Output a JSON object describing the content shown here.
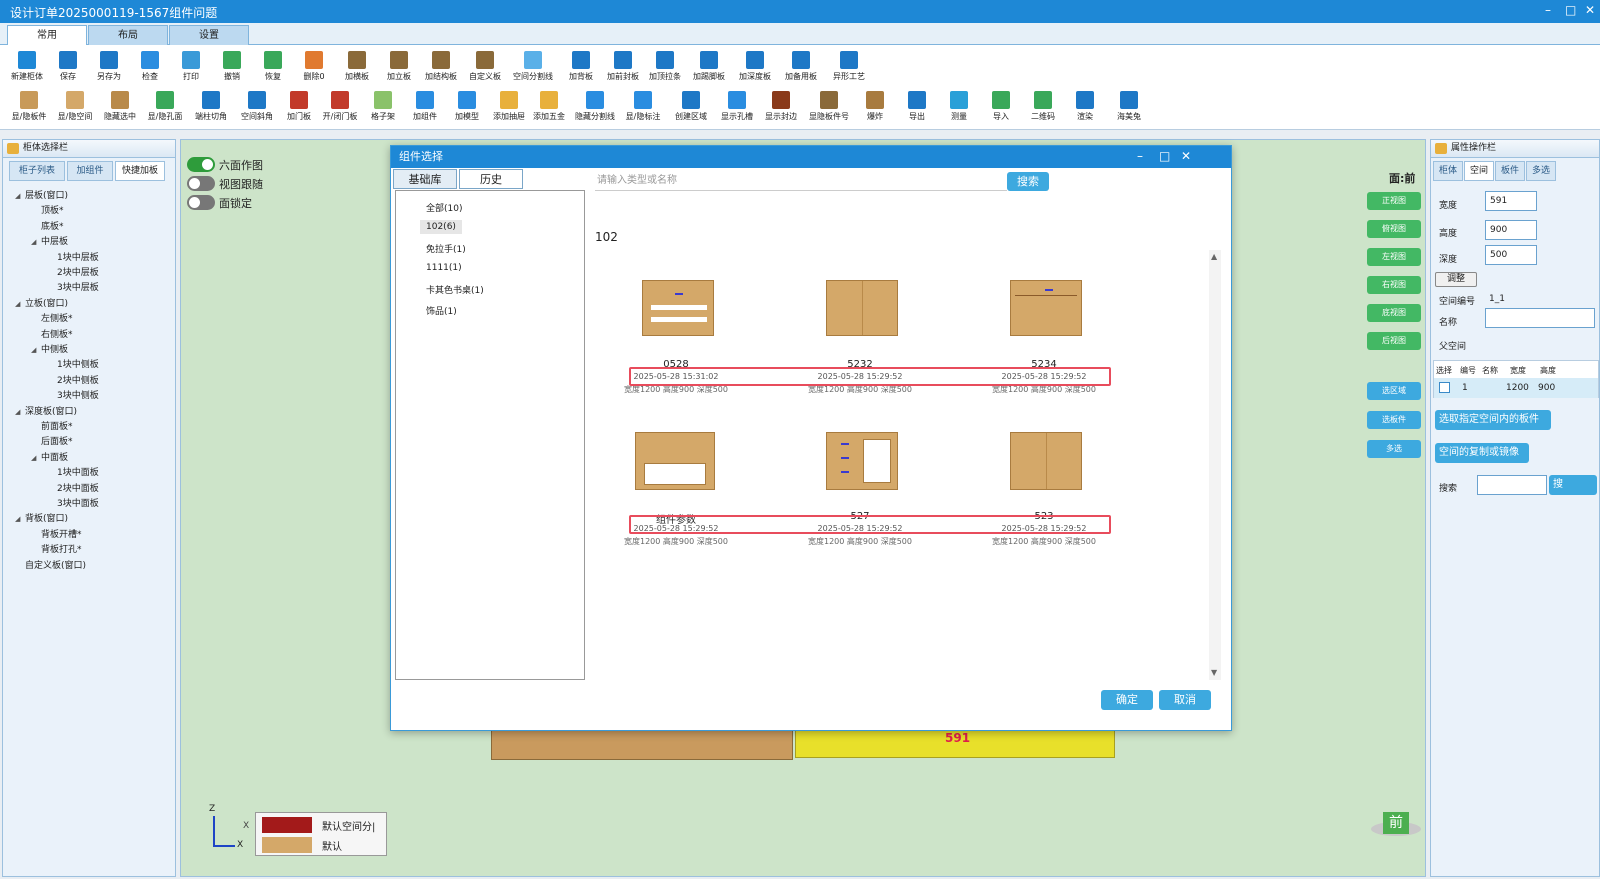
{
  "window": {
    "title": "设计订单2025000119-1567组件问题",
    "controls": [
      "–",
      "□",
      "✕"
    ]
  },
  "main_tabs": [
    {
      "label": "常用",
      "active": true
    },
    {
      "label": "布局",
      "active": false
    },
    {
      "label": "设置",
      "active": false
    }
  ],
  "ribbon_row1": [
    {
      "label": "新建柜体",
      "icon": "new-cabinet-icon",
      "color": "#1e88d6"
    },
    {
      "label": "保存",
      "icon": "save-icon",
      "color": "#1e78c6"
    },
    {
      "label": "另存为",
      "icon": "save-as-icon",
      "color": "#1e78c6"
    },
    {
      "label": "检查",
      "icon": "check-icon",
      "color": "#2a8de0"
    },
    {
      "label": "打印",
      "icon": "print-icon",
      "color": "#3a9ad8"
    },
    {
      "label": "撤销",
      "icon": "undo-icon",
      "color": "#3aa85a"
    },
    {
      "label": "恢复",
      "icon": "redo-icon",
      "color": "#3aa85a"
    },
    {
      "label": "删除0",
      "icon": "delete-icon",
      "color": "#e07a30"
    },
    {
      "label": "加横板",
      "icon": "add-horizontal-board-icon",
      "color": "#8a6a3a"
    },
    {
      "label": "加立板",
      "icon": "add-vertical-board-icon",
      "color": "#8a6a3a"
    },
    {
      "label": "加结构板",
      "icon": "add-structure-board-icon",
      "color": "#8a6a3a"
    },
    {
      "label": "自定义板",
      "icon": "custom-board-icon",
      "color": "#8a6a3a"
    },
    {
      "label": "空间分割线",
      "icon": "space-split-icon",
      "color": "#5ab0e8"
    },
    {
      "label": "加背板",
      "icon": "add-back-board-icon",
      "color": "#1e78c6"
    },
    {
      "label": "加前封板",
      "icon": "add-front-seal-icon",
      "color": "#1e78c6"
    },
    {
      "label": "加顶拉条",
      "icon": "add-top-strip-icon",
      "color": "#1e78c6"
    },
    {
      "label": "加踢脚板",
      "icon": "add-kick-board-icon",
      "color": "#1e78c6"
    },
    {
      "label": "加深度板",
      "icon": "add-depth-board-icon",
      "color": "#1e78c6"
    },
    {
      "label": "加备用板",
      "icon": "add-spare-board-icon",
      "color": "#1e78c6"
    },
    {
      "label": "异形工艺",
      "icon": "special-process-icon",
      "color": "#1e78c6"
    }
  ],
  "ribbon_row2": [
    {
      "label": "显/隐板件",
      "icon": "toggle-boards-icon",
      "color": "#c89a5a"
    },
    {
      "label": "显/隐空间",
      "icon": "toggle-space-icon",
      "color": "#d4a869"
    },
    {
      "label": "隐藏选中",
      "icon": "hide-selected-icon",
      "color": "#b98a4a"
    },
    {
      "label": "显/隐孔面",
      "icon": "toggle-hole-face-icon",
      "color": "#3aa85a"
    },
    {
      "label": "端柱切角",
      "icon": "post-chamfer-icon",
      "color": "#1e78c6"
    },
    {
      "label": "空间斜角",
      "icon": "space-bevel-icon",
      "color": "#1e78c6"
    },
    {
      "label": "加门板",
      "icon": "add-door-icon",
      "color": "#c23a2a"
    },
    {
      "label": "开/闭门板",
      "icon": "open-close-door-icon",
      "color": "#c23a2a"
    },
    {
      "label": "格子架",
      "icon": "grid-rack-icon",
      "color": "#8ac26a"
    },
    {
      "label": "加组件",
      "icon": "add-component-icon",
      "color": "#2a8de0"
    },
    {
      "label": "加模型",
      "icon": "add-model-icon",
      "color": "#2a8de0"
    },
    {
      "label": "添加抽屉",
      "icon": "add-drawer-icon",
      "color": "#e8b03c"
    },
    {
      "label": "添加五金",
      "icon": "add-hardware-icon",
      "color": "#e8b03c"
    },
    {
      "label": "隐藏分割线",
      "icon": "hide-split-line-icon",
      "color": "#2a8de0"
    },
    {
      "label": "显/隐标注",
      "icon": "toggle-annotation-icon",
      "color": "#2a8de0"
    },
    {
      "label": "创建区域",
      "icon": "create-area-icon",
      "color": "#1e78c6"
    },
    {
      "label": "显示孔槽",
      "icon": "show-hole-slot-icon",
      "color": "#2a8de0"
    },
    {
      "label": "显示封边",
      "icon": "show-edge-band-icon",
      "color": "#8a3a1a"
    },
    {
      "label": "显隐板件号",
      "icon": "toggle-board-number-icon",
      "color": "#8a6a3a"
    },
    {
      "label": "爆炸",
      "icon": "explode-icon",
      "color": "#a87b3f"
    },
    {
      "label": "导出",
      "icon": "export-icon",
      "color": "#1e78c6"
    },
    {
      "label": "测量",
      "icon": "measure-icon",
      "color": "#2aa0d8"
    },
    {
      "label": "导入",
      "icon": "import-icon",
      "color": "#3aa85a"
    },
    {
      "label": "二维码",
      "icon": "qrcode-icon",
      "color": "#3aa85a"
    },
    {
      "label": "渲染",
      "icon": "render-icon",
      "color": "#1e78c6"
    },
    {
      "label": "海美兔",
      "icon": "haimeitu-icon",
      "color": "#1e78c6"
    }
  ],
  "left_panel": {
    "title": "柜体选择栏",
    "tabs": [
      {
        "label": "柜子列表",
        "active": false
      },
      {
        "label": "加组件",
        "active": false
      },
      {
        "label": "快捷加板",
        "active": true
      }
    ],
    "tree": [
      {
        "label": "层板(窗口)",
        "level": 0,
        "expanded": true
      },
      {
        "label": "顶板*",
        "level": 1
      },
      {
        "label": "底板*",
        "level": 1
      },
      {
        "label": "中层板",
        "level": 1,
        "expanded": true
      },
      {
        "label": "1块中层板",
        "level": 2
      },
      {
        "label": "2块中层板",
        "level": 2
      },
      {
        "label": "3块中层板",
        "level": 2
      },
      {
        "label": "立板(窗口)",
        "level": 0,
        "expanded": true
      },
      {
        "label": "左侧板*",
        "level": 1
      },
      {
        "label": "右侧板*",
        "level": 1
      },
      {
        "label": "中侧板",
        "level": 1,
        "expanded": true
      },
      {
        "label": "1块中侧板",
        "level": 2
      },
      {
        "label": "2块中侧板",
        "level": 2
      },
      {
        "label": "3块中侧板",
        "level": 2
      },
      {
        "label": "深度板(窗口)",
        "level": 0,
        "expanded": true
      },
      {
        "label": "前面板*",
        "level": 1
      },
      {
        "label": "后面板*",
        "level": 1
      },
      {
        "label": "中面板",
        "level": 1,
        "expanded": true
      },
      {
        "label": "1块中面板",
        "level": 2
      },
      {
        "label": "2块中面板",
        "level": 2
      },
      {
        "label": "3块中面板",
        "level": 2
      },
      {
        "label": "背板(窗口)",
        "level": 0,
        "expanded": true
      },
      {
        "label": "背板开槽*",
        "level": 1
      },
      {
        "label": "背板打孔*",
        "level": 1
      },
      {
        "label": "自定义板(窗口)",
        "level": 0
      }
    ]
  },
  "canvas": {
    "toggles": [
      {
        "label": "六面作图",
        "on": true
      },
      {
        "label": "视图跟随",
        "on": false
      },
      {
        "label": "面锁定",
        "on": false
      }
    ],
    "face_label": "面:前",
    "view_buttons": [
      "正视图",
      "俯视图",
      "左视图",
      "右视图",
      "底视图",
      "后视图"
    ],
    "select_buttons": [
      "选区域",
      "选板件",
      "多选"
    ],
    "dimension_text": "591",
    "axis": {
      "z": "Z",
      "x": "X",
      "y": "X"
    },
    "legend": [
      {
        "label": "默认空间分|",
        "color": "#a31a1a"
      },
      {
        "label": "默认",
        "color": "#d4a869"
      }
    ],
    "front_badge": "前"
  },
  "right_panel": {
    "title": "属性操作栏",
    "tabs": [
      {
        "label": "柜体",
        "active": false
      },
      {
        "label": "空间",
        "active": true
      },
      {
        "label": "板件",
        "active": false
      },
      {
        "label": "多选",
        "active": false
      }
    ],
    "width_label": "宽度",
    "width_value": "591",
    "height_label": "高度",
    "height_value": "900",
    "depth_label": "深度",
    "depth_value": "500",
    "adjust_button": "调整",
    "space_no_label": "空间编号",
    "space_no_value": "1_1",
    "name_label": "名称",
    "name_value": "",
    "parent_label": "父空间",
    "table_headers": [
      "选择",
      "编号",
      "名称",
      "宽度",
      "高度"
    ],
    "table_rows": [
      {
        "no": "1",
        "name": "",
        "width": "1200",
        "height": "900"
      }
    ],
    "select_boards_button": "选取指定空间内的板件",
    "copy_mirror_button": "空间的复制或镜像",
    "search_label": "搜索",
    "search_value": "",
    "search_button": "搜"
  },
  "dialog": {
    "title": "组件选择",
    "tabs": [
      {
        "label": "基础库",
        "active": false
      },
      {
        "label": "历史",
        "active": true
      }
    ],
    "search_placeholder": "请输入类型或名称",
    "search_button": "搜索",
    "categories": [
      {
        "label": "全部(10)",
        "selected": false
      },
      {
        "label": "102(6)",
        "selected": true
      },
      {
        "label": "免拉手(1)",
        "selected": false
      },
      {
        "label": "1111(1)",
        "selected": false
      },
      {
        "label": "卡其色书桌(1)",
        "selected": false
      },
      {
        "label": "饰品(1)",
        "selected": false
      }
    ],
    "section_title": "102",
    "items": [
      {
        "name": "0528",
        "time": "2025-05-28 15:31:02",
        "dims": "宽度1200 高度900 深度500"
      },
      {
        "name": "5232",
        "time": "2025-05-28 15:29:52",
        "dims": "宽度1200 高度900 深度500"
      },
      {
        "name": "5234",
        "time": "2025-05-28 15:29:52",
        "dims": "宽度1200 高度900 深度500"
      },
      {
        "name": "组件参数",
        "time": "2025-05-28 15:29:52",
        "dims": "宽度1200 高度900 深度500"
      },
      {
        "name": "527",
        "time": "2025-05-28 15:29:52",
        "dims": "宽度1200 高度900 深度500"
      },
      {
        "name": "523",
        "time": "2025-05-28 15:29:52",
        "dims": "宽度1200 高度900 深度500"
      }
    ],
    "ok_button": "确定",
    "cancel_button": "取消"
  }
}
